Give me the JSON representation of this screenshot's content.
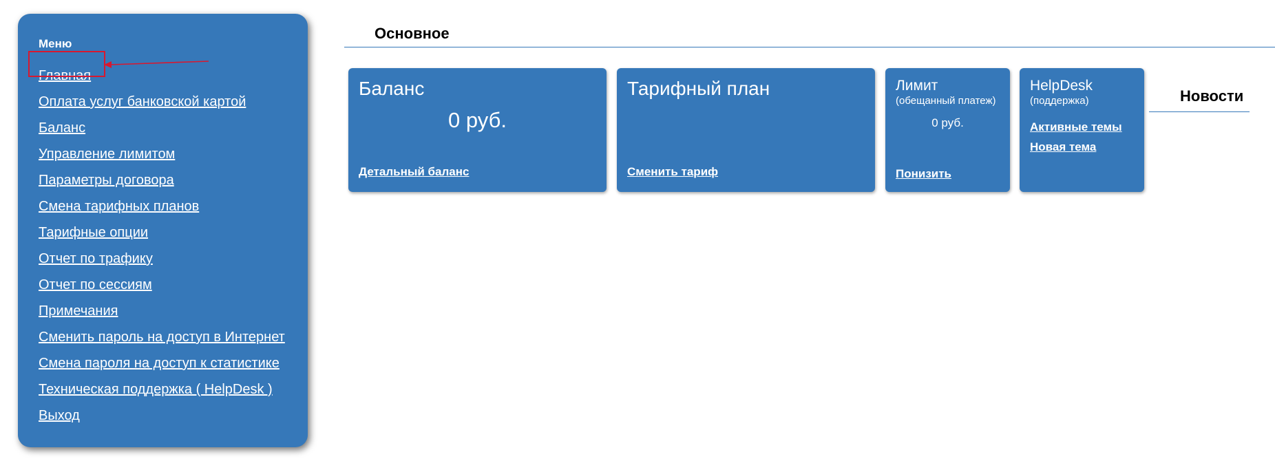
{
  "sidebar": {
    "title": "Меню",
    "items": [
      {
        "label": "Главная"
      },
      {
        "label": "Оплата услуг банковской картой"
      },
      {
        "label": "Баланс"
      },
      {
        "label": "Управление лимитом"
      },
      {
        "label": "Параметры договора"
      },
      {
        "label": "Смена тарифных планов"
      },
      {
        "label": "Тарифные опции"
      },
      {
        "label": "Отчет по трафику"
      },
      {
        "label": "Отчет по сессиям"
      },
      {
        "label": "Примечания"
      },
      {
        "label": "Сменить пароль на доступ в Интернет"
      },
      {
        "label": "Смена пароля на доступ к статистике"
      },
      {
        "label": "Техническая поддержка ( HelpDesk )"
      },
      {
        "label": "Выход"
      }
    ]
  },
  "main": {
    "title": "Основное"
  },
  "tiles": {
    "balance": {
      "title": "Баланс",
      "amount": "0 руб.",
      "link": "Детальный баланс"
    },
    "tariff": {
      "title": "Тарифный план",
      "link": "Сменить тариф"
    },
    "limit": {
      "title": "Лимит",
      "subtitle": "(обещанный платеж)",
      "amount": "0 руб.",
      "link": "Понизить"
    },
    "helpdesk": {
      "title": "HelpDesk",
      "subtitle": "(поддержка)",
      "links": [
        "Активные темы",
        "Новая тема"
      ]
    }
  },
  "news": {
    "title": "Новости"
  },
  "colors": {
    "panel": "#3678b9",
    "annotation": "#d8182f"
  }
}
